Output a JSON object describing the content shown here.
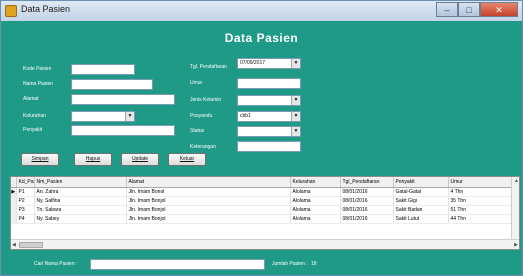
{
  "window": {
    "title": "Data Pasien",
    "min_glyph": "–",
    "max_glyph": "□",
    "close_glyph": "✕"
  },
  "form_title": "Data Pasien",
  "left_fields": {
    "kode_label": "Kode Pasien",
    "kode_value": "",
    "nama_label": "Nama Pasien",
    "nama_value": "",
    "alamat_label": "Alamat",
    "alamat_value": "",
    "kelurahan_label": "Kelurahan",
    "kelurahan_value": "",
    "penyakit_label": "Penyakit",
    "penyakit_value": ""
  },
  "right_fields": {
    "tgl_label": "Tgl. Pendaftaran",
    "tgl_value": "07/09/2017",
    "umur_label": "Umur",
    "umur_value": "",
    "jk_label": "Jenis Kelamin",
    "jk_value": "",
    "posyandu_label": "Posyandu",
    "posyandu_value": "cbb1",
    "status_label": "Status",
    "status_value": "",
    "keterangan_label": "Keterangan",
    "keterangan_value": ""
  },
  "buttons": {
    "simpan": "Simpan",
    "hapus": "Hapus",
    "update": "Update",
    "keluar": "Keluar"
  },
  "grid": {
    "columns": [
      "Kd_Pasien",
      "Nm_Pasien",
      "Alamat",
      "Kelurahan",
      "Tgl_Pendaftaran",
      "Penyakit",
      "Umur"
    ],
    "rows": [
      [
        "P1",
        "An. Zahra",
        "Jln. Imam Bonol",
        "Alolama",
        "08/01/2016",
        "Gatal-Gatal",
        "4 Thn"
      ],
      [
        "P2",
        "Ny. Salfina",
        "Jln. Imam Bonjol",
        "Alolama",
        "08/01/2016",
        "Sakit Gigi",
        "35 Thn"
      ],
      [
        "P3",
        "Tn. Sabara",
        "Jln. Imam Bonjol",
        "Alolama",
        "08/01/2016",
        "Sakit Badan",
        "51 Thn"
      ],
      [
        "P4",
        "Ny. Sabey",
        "Jln. Imam Bonjol",
        "Alolama",
        "08/01/2016",
        "Sakit Lutut",
        "44 Thn"
      ]
    ],
    "current_row_marker": "▶"
  },
  "search": {
    "label": "Cari Nama Pasien :",
    "value": ""
  },
  "total": {
    "label": "Jumlah Pasien :",
    "value": "18"
  }
}
